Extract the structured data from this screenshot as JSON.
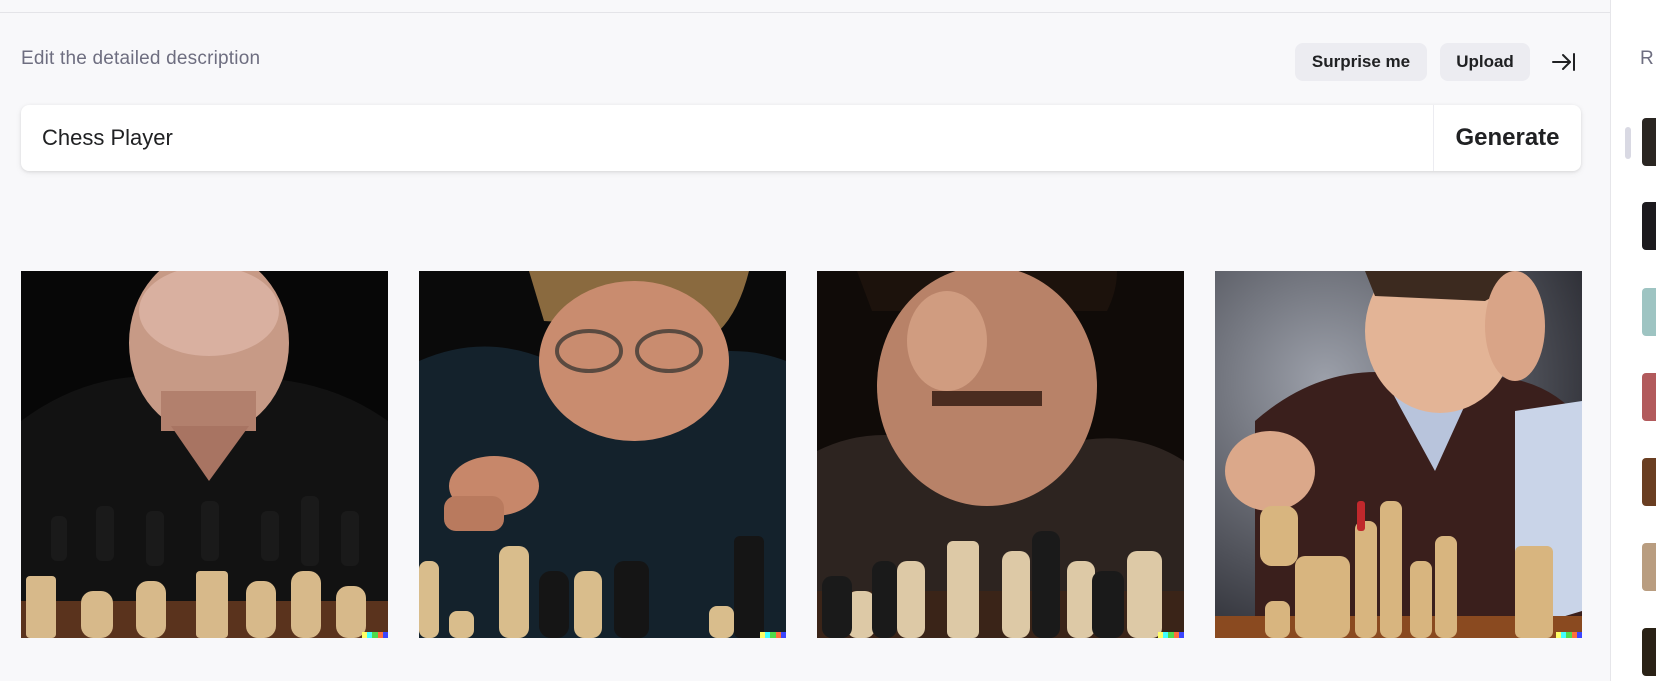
{
  "header": {
    "title": "Edit the detailed description",
    "surprise_label": "Surprise me",
    "upload_label": "Upload",
    "collapse_icon": "collapse-right-icon"
  },
  "prompt": {
    "value": "Chess Player",
    "generate_label": "Generate"
  },
  "results": [
    {
      "subject": "bald man in black shirt behind chess pieces",
      "icon": "generated-image"
    },
    {
      "subject": "man with glasses moving a white pawn",
      "icon": "generated-image"
    },
    {
      "subject": "intense man close-up above chess board",
      "icon": "generated-image"
    },
    {
      "subject": "smiling young man moving a chess piece",
      "icon": "generated-image"
    }
  ],
  "sidebar": {
    "title": "R",
    "thumbnail_count": 7
  },
  "colors": {
    "background": "#f8f8fa",
    "pill": "#ececf1",
    "text": "#202123",
    "muted": "#6e6e80",
    "signature": [
      "#ffff66",
      "#42ffff",
      "#51da4c",
      "#ff6e3c",
      "#3c46ff"
    ]
  }
}
